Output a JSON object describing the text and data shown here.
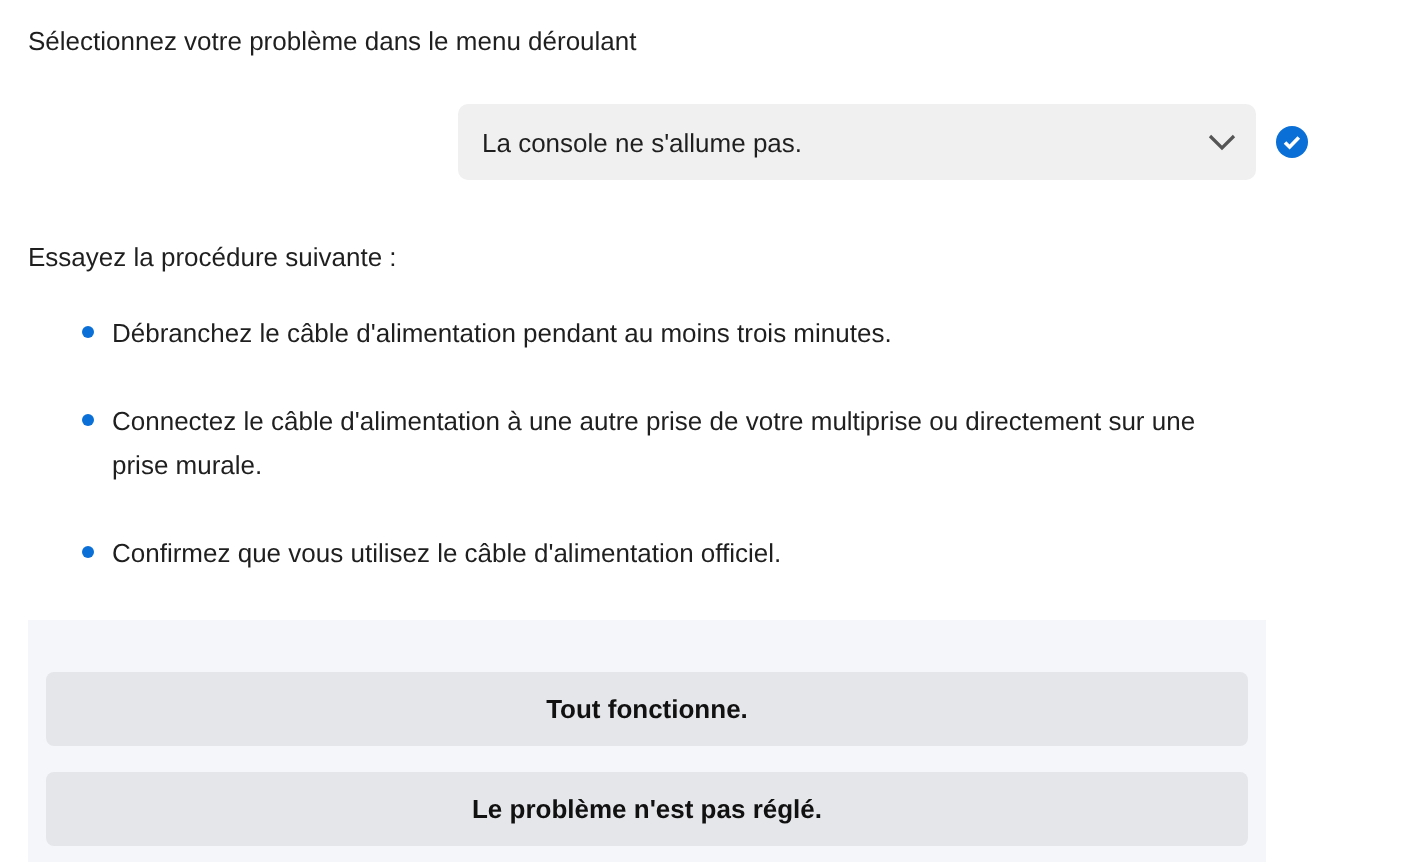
{
  "prompt": "Sélectionnez votre problème dans le menu déroulant",
  "dropdown": {
    "value": "La console ne s'allume pas.",
    "valid": true
  },
  "instructions_heading": "Essayez la procédure suivante :",
  "steps": [
    {
      "text": " Débranchez le câble d'alimentation pendant au moins trois minutes."
    },
    {
      "text": "Connectez le câble d'alimentation à une autre prise de votre multiprise ou directement sur une prise murale."
    },
    {
      "text": "Confirmez que vous utilisez le câble d'alimentation officiel."
    }
  ],
  "buttons": [
    "Tout fonctionne.",
    "Le problème n'est pas réglé."
  ]
}
